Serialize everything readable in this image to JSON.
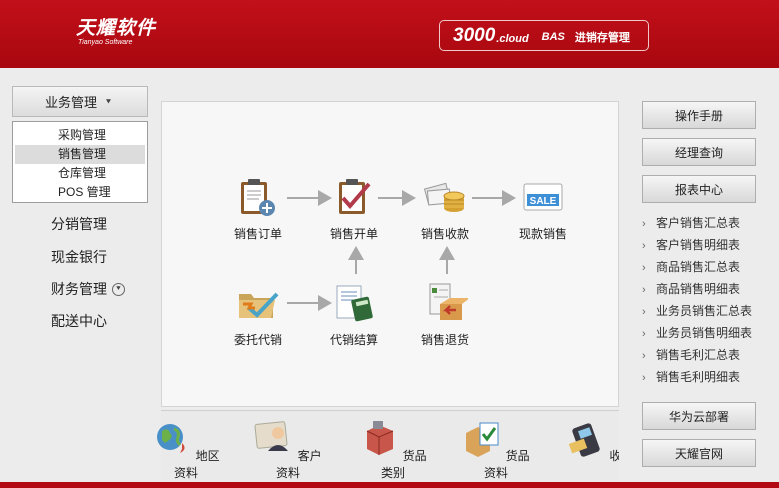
{
  "header": {
    "logo_cn": "天耀软件",
    "logo_en": "Tianyao Software",
    "product_num": "3000",
    "product_cloud": ".cloud",
    "product_bas": "BAS",
    "product_name": "进销存管理"
  },
  "left_nav": {
    "business_label": "业务管理",
    "submenu": [
      "采购管理",
      "销售管理",
      "仓库管理",
      "POS 管理"
    ],
    "selected_index": 1,
    "items": [
      "分销管理",
      "现金银行",
      "财务管理",
      "配送中心"
    ]
  },
  "flow": {
    "order": "销售订单",
    "invoice": "销售开单",
    "collect": "销售收款",
    "cash_sale": "现款销售",
    "consign": "委托代销",
    "consign_settle": "代销结算",
    "sales_return": "销售退货",
    "sale_tag": "SALE"
  },
  "bottom": [
    "地区资料",
    "客户资料",
    "货品类别",
    "货品资料",
    "收付款"
  ],
  "right_nav": {
    "manual": "操作手册",
    "manager_query": "经理查询",
    "report_center": "报表中心",
    "reports": [
      "客户销售汇总表",
      "客户销售明细表",
      "商品销售汇总表",
      "商品销售明细表",
      "业务员销售汇总表",
      "业务员销售明细表",
      "销售毛利汇总表",
      "销售毛利明细表"
    ],
    "huawei": "华为云部署",
    "official_site": "天耀官网"
  },
  "colors": {
    "brand_red": "#b80b14",
    "panel_bg": "#f7f7f7"
  }
}
